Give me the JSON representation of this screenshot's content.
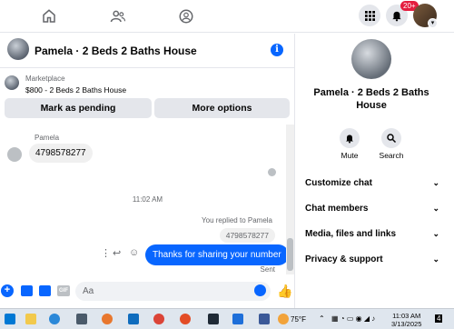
{
  "notifications": {
    "badge": "20+"
  },
  "chat": {
    "title": "Pamela · 2 Beds 2 Baths House",
    "marketplace_label": "Marketplace",
    "listing": "$800 - 2 Beds 2 Baths House",
    "buttons": {
      "pending": "Mark as pending",
      "more": "More options"
    },
    "messages": {
      "sender": "Pamela",
      "incoming": "4798578277",
      "timestamp": "11:02 AM",
      "replied_note": "You replied to Pamela",
      "quoted": "4798578277",
      "outgoing": "Thanks for sharing your number",
      "status": "Sent"
    },
    "composer_placeholder": "Aa"
  },
  "side": {
    "name": "Pamela · 2 Beds 2 Baths House",
    "actions": [
      {
        "label": "Mute",
        "icon": "bell-icon"
      },
      {
        "label": "Search",
        "icon": "search-icon"
      }
    ],
    "sections": [
      "Customize chat",
      "Chat members",
      "Media, files and links",
      "Privacy & support"
    ]
  },
  "taskbar": {
    "weather": "75°F",
    "time": "11:03 AM",
    "date": "3/13/2025",
    "notification_count": "4"
  },
  "colors": {
    "accent": "#0866ff",
    "badge": "#e41e3f"
  }
}
